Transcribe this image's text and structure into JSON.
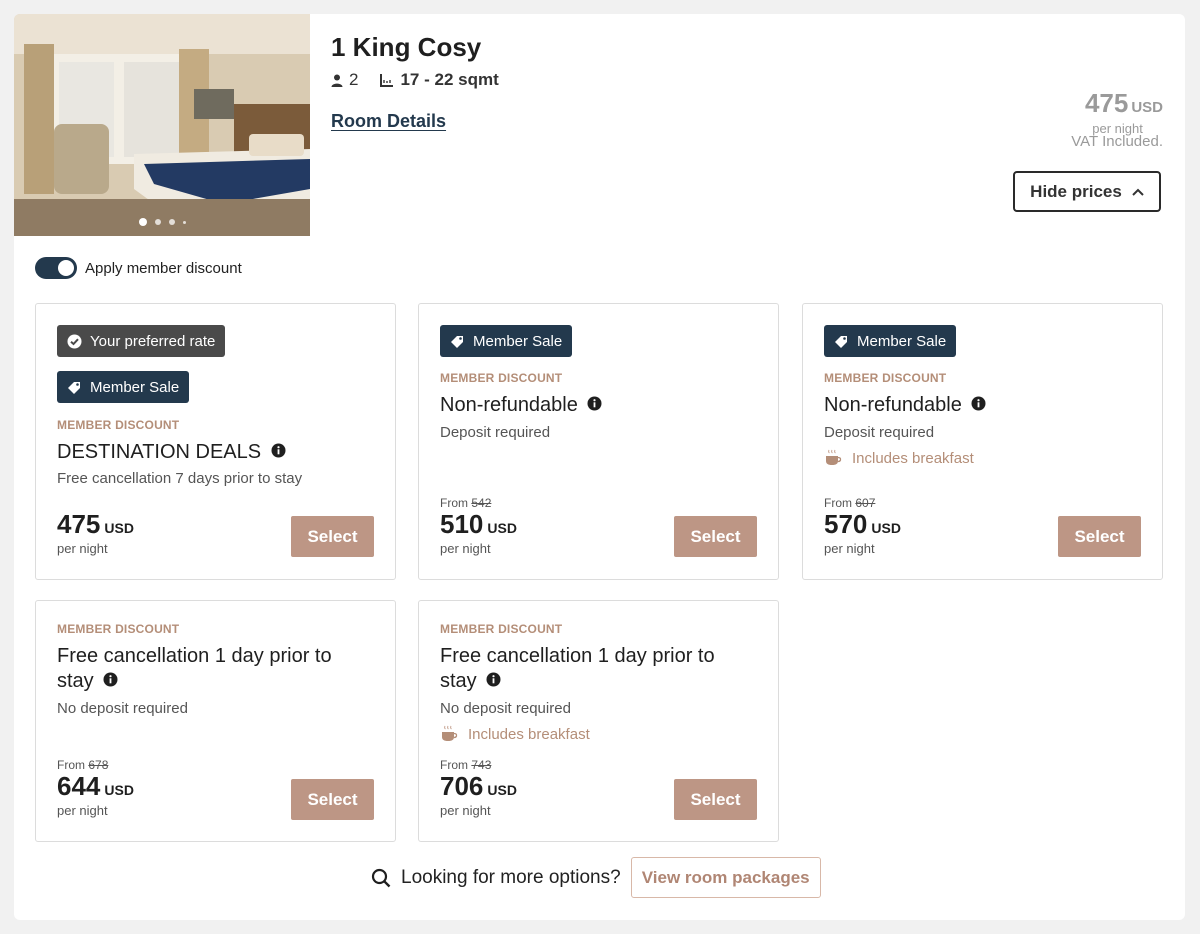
{
  "room": {
    "title": "1 King Cosy",
    "guests": "2",
    "size": "17 - 22 sqmt",
    "details_link": "Room Details"
  },
  "summary_price": {
    "amount": "475",
    "currency": "USD",
    "per": "per night",
    "vat": "VAT Included."
  },
  "hide_prices_label": "Hide prices",
  "member_toggle": {
    "label": "Apply member discount",
    "on": true
  },
  "rates": [
    {
      "preferred_badge": "Your preferred rate",
      "sale_badge": "Member Sale",
      "category": "MEMBER DISCOUNT",
      "name": "DESTINATION DEALS",
      "condition": "Free cancellation 7 days prior to stay",
      "price": "475",
      "currency": "USD",
      "per": "per night",
      "select": "Select"
    },
    {
      "sale_badge": "Member Sale",
      "category": "MEMBER DISCOUNT",
      "name": "Non-refundable",
      "condition": "Deposit required",
      "from_label": "From",
      "old_price": "542",
      "price": "510",
      "currency": "USD",
      "per": "per night",
      "select": "Select"
    },
    {
      "sale_badge": "Member Sale",
      "category": "MEMBER DISCOUNT",
      "name": "Non-refundable",
      "condition": "Deposit required",
      "extra": "Includes breakfast",
      "from_label": "From",
      "old_price": "607",
      "price": "570",
      "currency": "USD",
      "per": "per night",
      "select": "Select"
    },
    {
      "category": "MEMBER DISCOUNT",
      "name_line1": "Free cancellation 1 day prior to",
      "name_line2": "stay",
      "condition": "No deposit required",
      "from_label": "From",
      "old_price": "678",
      "price": "644",
      "currency": "USD",
      "per": "per night",
      "select": "Select"
    },
    {
      "category": "MEMBER DISCOUNT",
      "name_line1": "Free cancellation 1 day prior to",
      "name_line2": "stay",
      "condition": "No deposit required",
      "extra": "Includes breakfast",
      "from_label": "From",
      "old_price": "743",
      "price": "706",
      "currency": "USD",
      "per": "per night",
      "select": "Select"
    }
  ],
  "footer": {
    "question": "Looking for more options?",
    "packages_button": "View room packages"
  },
  "colors": {
    "navy": "#23394d",
    "accent": "#bd9685",
    "accent_text": "#b48e78",
    "muted": "#9a9a9a"
  },
  "icons": [
    "person-icon",
    "area-icon",
    "chevron-up-icon",
    "check-circle-icon",
    "tag-icon",
    "info-icon",
    "coffee-cup-icon",
    "search-icon"
  ]
}
